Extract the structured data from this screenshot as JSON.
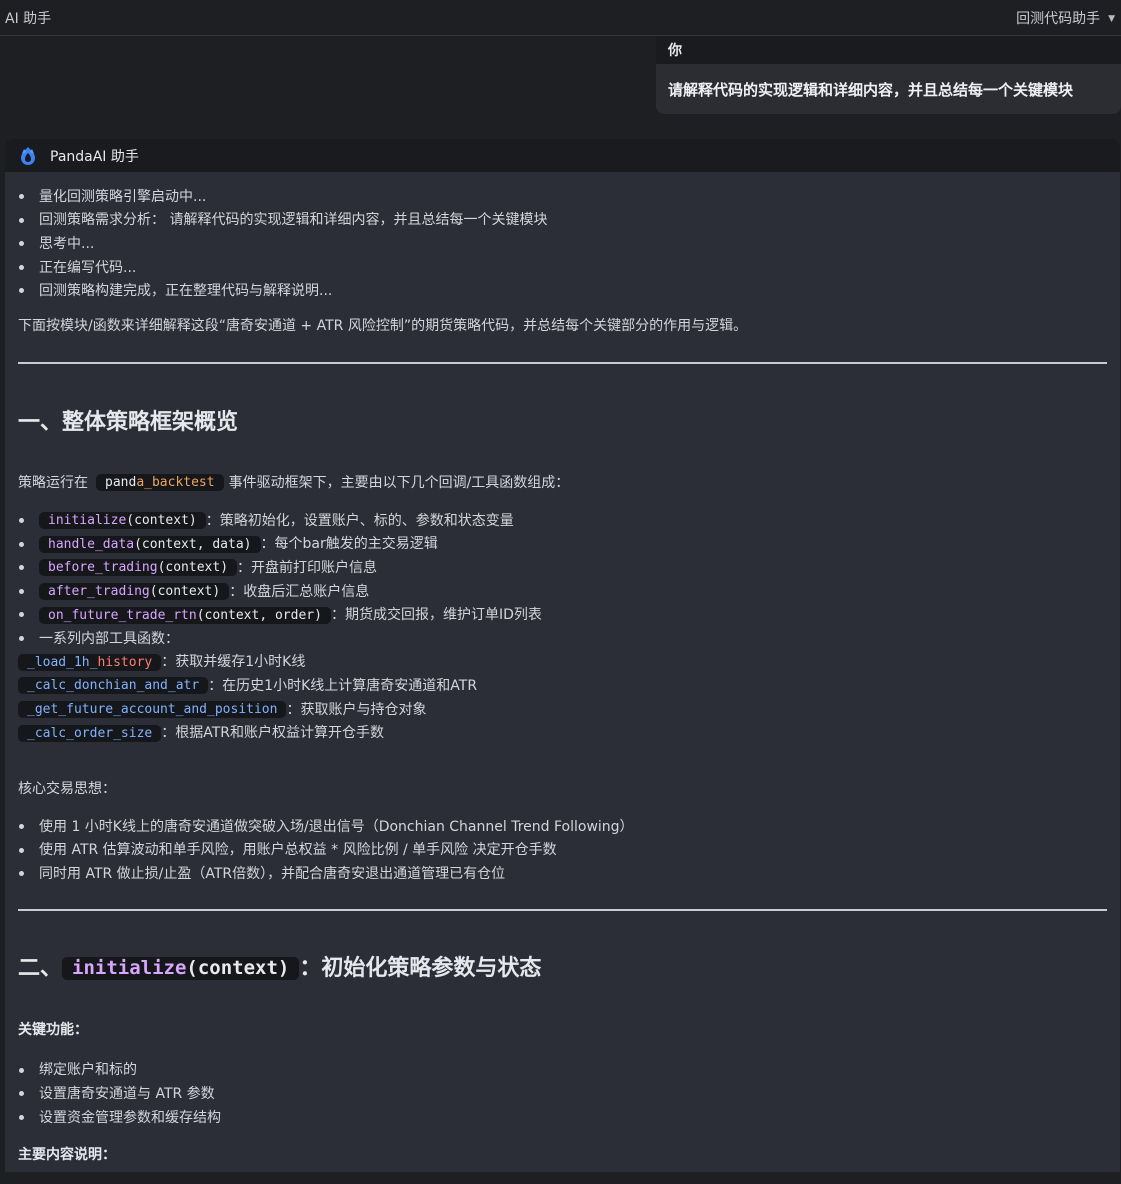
{
  "topbar": {
    "title": "AI 助手",
    "mode_label": "回测代码助手"
  },
  "user_message": {
    "sender": "你",
    "text": "请解释代码的实现逻辑和详细内容，并且总结每一个关键模块"
  },
  "assistant": {
    "name": "PandaAI 助手",
    "steps": [
      "量化回测策略引擎启动中...",
      "回测策略需求分析： 请解释代码的实现逻辑和详细内容，并且总结每一个关键模块",
      "思考中...",
      "正在编写代码...",
      "回测策略构建完成，正在整理代码与解释说明..."
    ],
    "intro": "下面按模块/函数来详细解释这段“唐奇安通道 + ATR 风险控制”的期货策略代码，并总结每个关键部分的作用与逻辑。",
    "section1": {
      "heading": "一、整体策略框架概览",
      "lead_before": "策略运行在",
      "lead_code_a": "pand",
      "lead_code_b": "a_backtest",
      "lead_after": "事件驱动框架下，主要由以下几个回调/工具函数组成：",
      "callbacks": [
        {
          "fn": "initialize",
          "args": "(context)",
          "desc": "：策略初始化，设置账户、标的、参数和状态变量"
        },
        {
          "fn": "handle_data",
          "args": "(context, data)",
          "desc": "：每个bar触发的主交易逻辑"
        },
        {
          "fn": "before_trading",
          "args": "(context)",
          "desc": "：开盘前打印账户信息"
        },
        {
          "fn": "after_trading",
          "args": "(context)",
          "desc": "：收盘后汇总账户信息"
        },
        {
          "fn": "on_future_trade_rtn",
          "args": "(context, order)",
          "desc": "：期货成交回报，维护订单ID列表"
        }
      ],
      "tools_label": "一系列内部工具函数：",
      "tools": [
        {
          "fn_a": "_load_1h_",
          "fn_b": "history",
          "desc": "：获取并缓存1小时K线"
        },
        {
          "fn_a": "_calc_donchian_and_atr",
          "fn_b": "",
          "desc": "：在历史1小时K线上计算唐奇安通道和ATR"
        },
        {
          "fn_a": "_get_future_account_and_position",
          "fn_b": "",
          "desc": "：获取账户与持仓对象"
        },
        {
          "fn_a": "_calc_order_size",
          "fn_b": "",
          "desc": "：根据ATR和账户权益计算开仓手数"
        }
      ],
      "core_label": "核心交易思想：",
      "core_points": [
        "使用 1 小时K线上的唐奇安通道做突破入场/退出信号（Donchian Channel Trend Following）",
        "使用 ATR 估算波动和单手风险，用账户总权益 * 风险比例 / 单手风险 决定开仓手数",
        "同时用 ATR 做止损/止盈（ATR倍数），并配合唐奇安退出通道管理已有仓位"
      ]
    },
    "section2": {
      "heading_prefix": "二、",
      "heading_fn": "initialize",
      "heading_args": "(context)",
      "heading_suffix": "：初始化策略参数与状态",
      "key_label": "关键功能：",
      "key_points": [
        "绑定账户和标的",
        "设置唐奇安通道与 ATR 参数",
        "设置资金管理参数和缓存结构"
      ],
      "detail_label": "主要内容说明："
    }
  }
}
